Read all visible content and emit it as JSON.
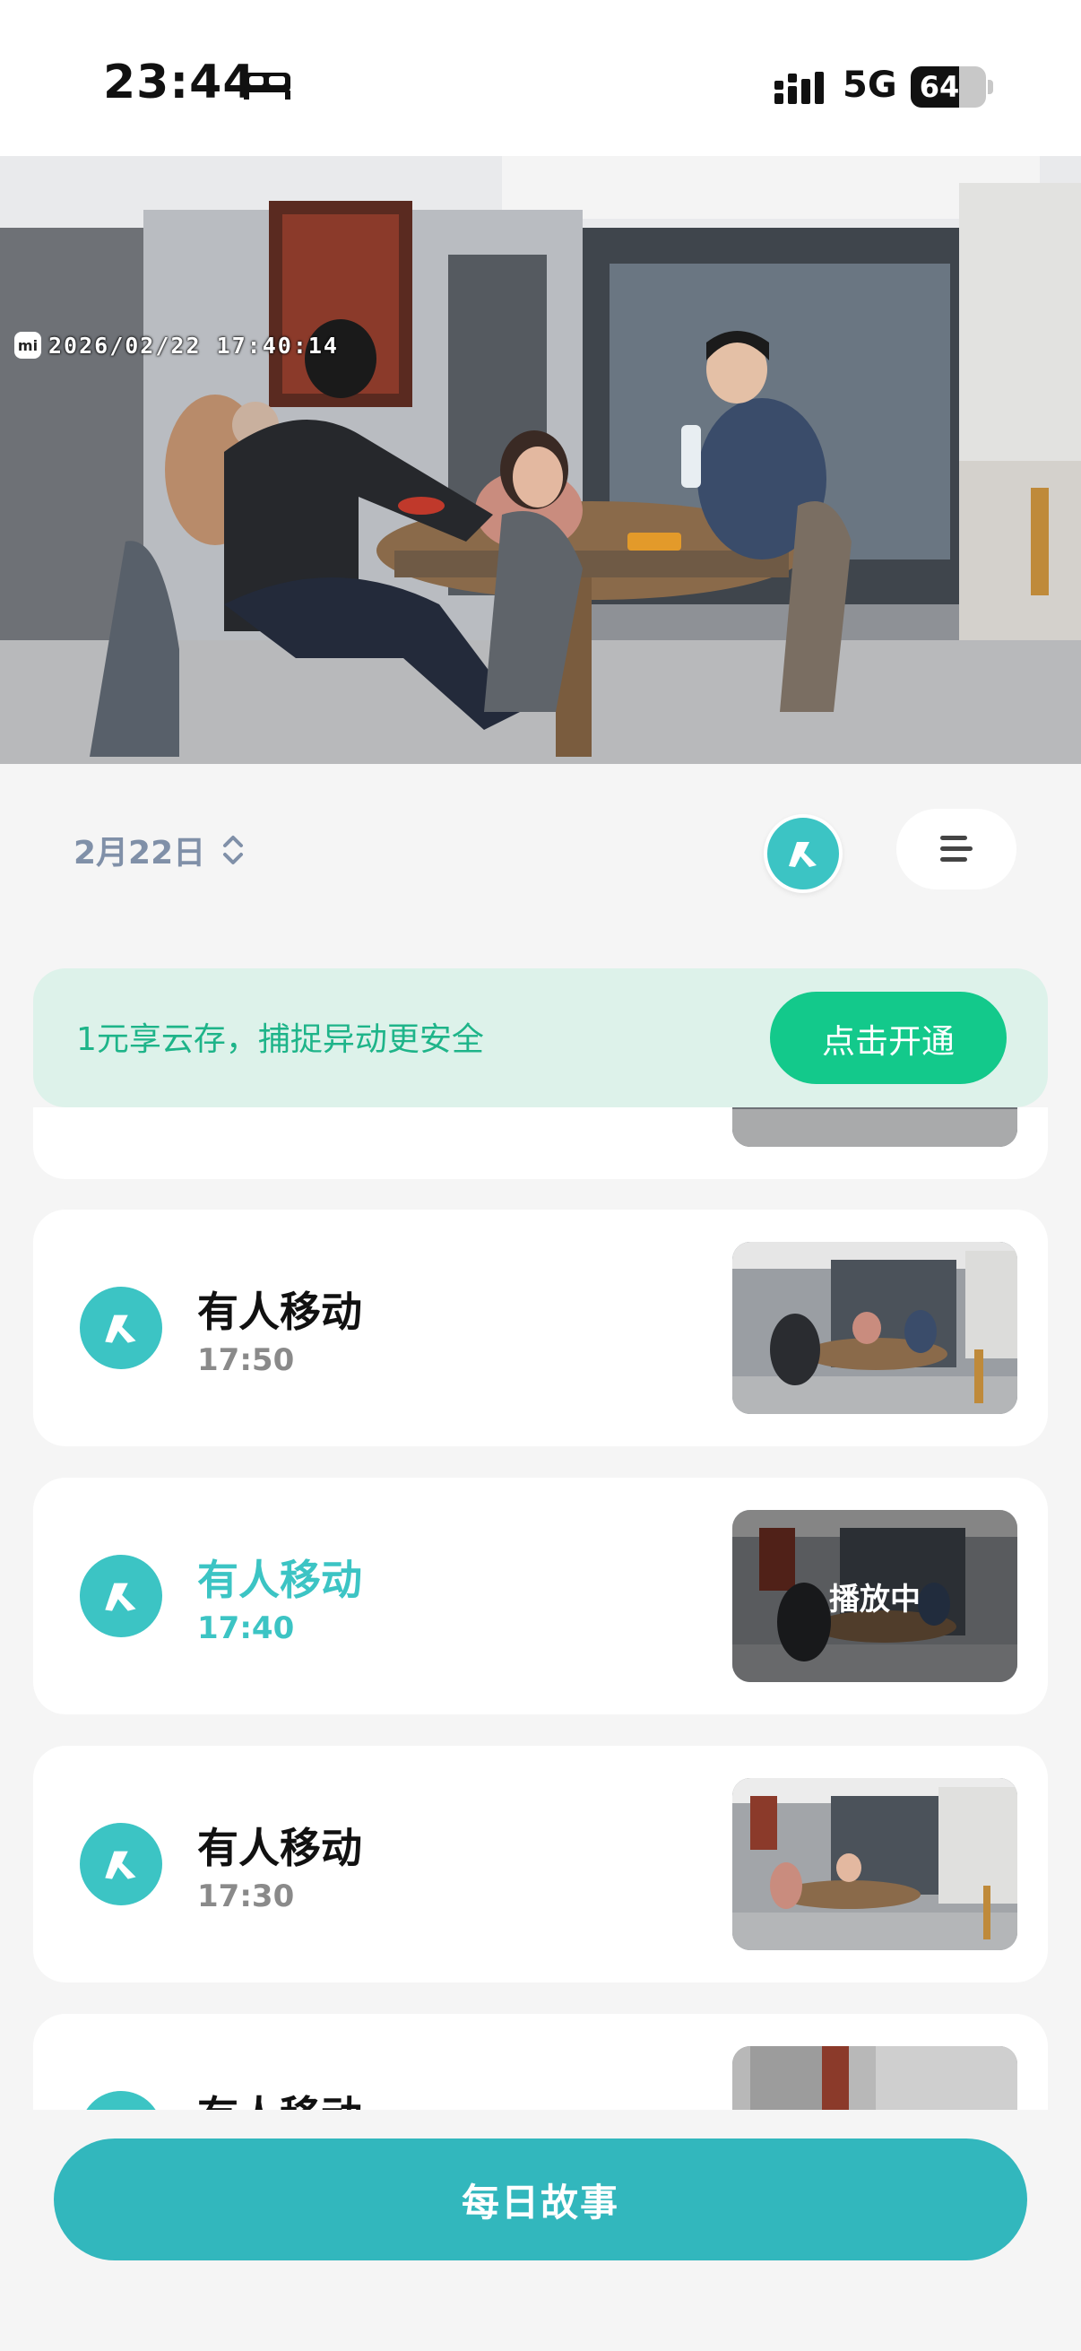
{
  "status_bar": {
    "time": "23:44",
    "network": "5G",
    "battery": "64",
    "battery_level": 0.64
  },
  "camera": {
    "timestamp": "2026/02/22  17:40:14",
    "brand_badge": "mi"
  },
  "controls": {
    "date_label": "2月22日"
  },
  "promo": {
    "message": "1元享云存，捕捉异动更安全",
    "button_label": "点击开通"
  },
  "events": [
    {
      "title": "",
      "time": "",
      "active": false,
      "overlay": ""
    },
    {
      "title": "有人移动",
      "time": "17:50",
      "active": false,
      "overlay": ""
    },
    {
      "title": "有人移动",
      "time": "17:40",
      "active": true,
      "overlay": "播放中"
    },
    {
      "title": "有人移动",
      "time": "17:30",
      "active": false,
      "overlay": ""
    },
    {
      "title": "有人移动",
      "time": "",
      "active": false,
      "overlay": ""
    }
  ],
  "footer": {
    "daily_story_label": "每日故事"
  },
  "colors": {
    "accent": "#3cc4c4",
    "promo_bg": "#ddf2ea",
    "promo_btn": "#13c98b",
    "story_btn": "#32b7bd"
  }
}
